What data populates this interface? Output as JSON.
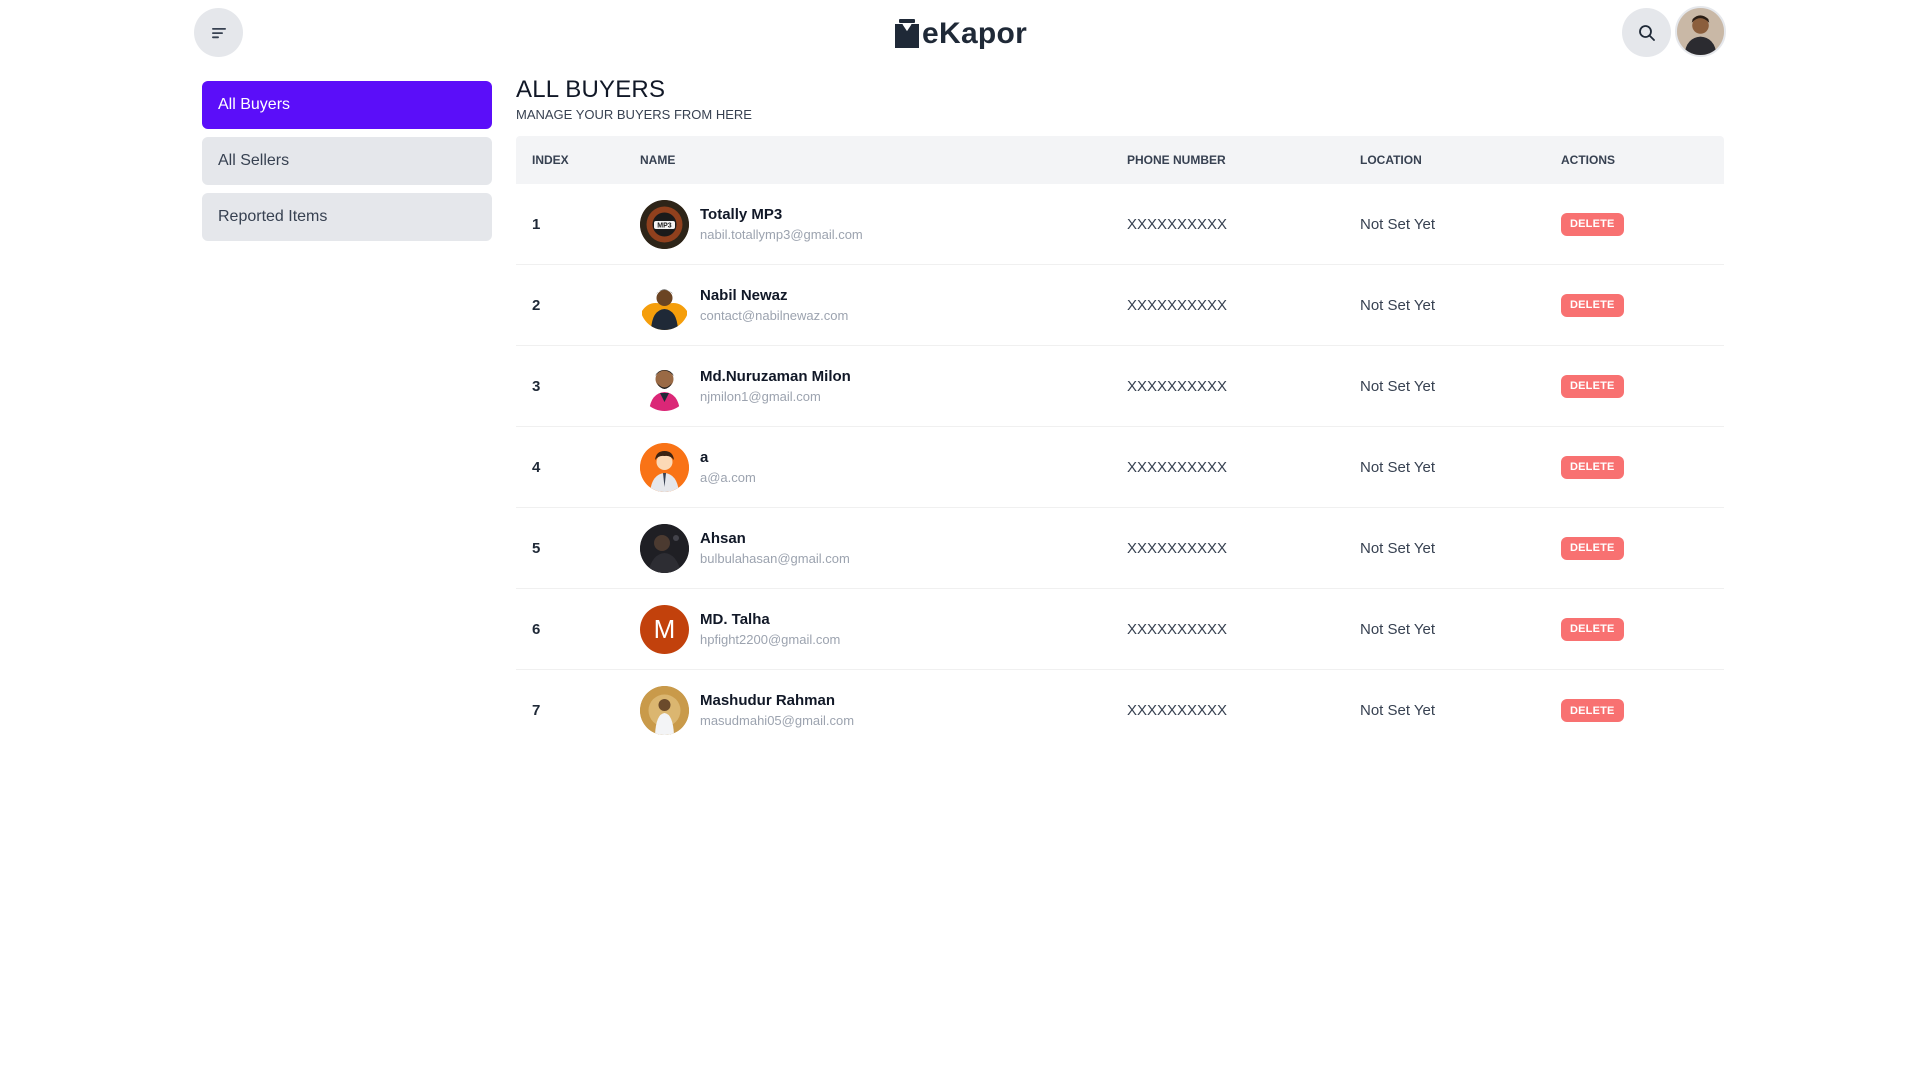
{
  "brand": {
    "name": "eKapor"
  },
  "header": {
    "menu_icon": "menu-icon",
    "search_icon": "search-icon",
    "avatar_icon": "user-avatar"
  },
  "sidebar": {
    "items": [
      {
        "label": "All Buyers",
        "active": true
      },
      {
        "label": "All Sellers",
        "active": false
      },
      {
        "label": "Reported Items",
        "active": false
      }
    ]
  },
  "main": {
    "title": "ALL BUYERS",
    "subtitle": "MANAGE YOUR BUYERS FROM HERE"
  },
  "table": {
    "headers": [
      "INDEX",
      "NAME",
      "PHONE NUMBER",
      "LOCATION",
      "ACTIONS"
    ],
    "rows": [
      {
        "index": "1",
        "name": "Totally MP3",
        "email": "nabil.totallymp3@gmail.com",
        "phone": "XXXXXXXXXX",
        "location": "Not Set Yet",
        "action": "DELETE",
        "avatar_color": "#3b2f1e"
      },
      {
        "index": "2",
        "name": "Nabil Newaz",
        "email": "contact@nabilnewaz.com",
        "phone": "XXXXXXXXXX",
        "location": "Not Set Yet",
        "action": "DELETE",
        "avatar_color": "#f59e0b"
      },
      {
        "index": "3",
        "name": "Md.Nuruzaman Milon",
        "email": "njmilon1@gmail.com",
        "phone": "XXXXXXXXXX",
        "location": "Not Set Yet",
        "action": "DELETE",
        "avatar_color": "#ffffff"
      },
      {
        "index": "4",
        "name": "a",
        "email": "a@a.com",
        "phone": "XXXXXXXXXX",
        "location": "Not Set Yet",
        "action": "DELETE",
        "avatar_color": "#f97316"
      },
      {
        "index": "5",
        "name": "Ahsan",
        "email": "bulbulahasan@gmail.com",
        "phone": "XXXXXXXXXX",
        "location": "Not Set Yet",
        "action": "DELETE",
        "avatar_color": "#1f1f24"
      },
      {
        "index": "6",
        "name": "MD. Talha",
        "email": "hpfight2200@gmail.com",
        "phone": "XXXXXXXXXX",
        "location": "Not Set Yet",
        "action": "DELETE",
        "avatar_color": "#c2410c",
        "avatar_letter": "M"
      },
      {
        "index": "7",
        "name": "Mashudur Rahman",
        "email": "masudmahi05@gmail.com",
        "phone": "XXXXXXXXXX",
        "location": "Not Set Yet",
        "action": "DELETE",
        "avatar_color": "#b7893b"
      }
    ]
  },
  "colors": {
    "primary": "#5b0ef9",
    "danger": "#f87171"
  }
}
